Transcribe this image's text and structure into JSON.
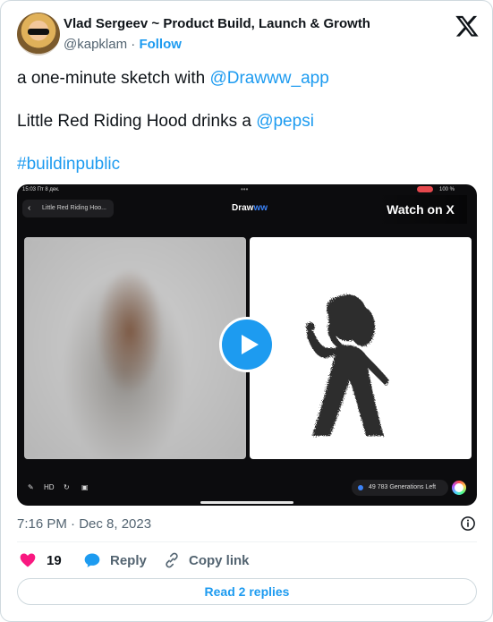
{
  "author": {
    "name": "Vlad Sergeev ~ Product Build, Launch & Growth",
    "handle": "@kapklam",
    "separator": "·",
    "follow_label": "Follow"
  },
  "tweet": {
    "line1_text": "a one-minute sketch with ",
    "line1_mention": "@Drawww_app",
    "line2_text": "Little Red Riding Hood drinks a ",
    "line2_mention": "@pepsi",
    "hashtag": "#buildinpublic"
  },
  "video": {
    "status_time": "15:03  Пт 8 дек.",
    "status_dots": "•••",
    "status_battery": "100 %",
    "app_title": "Little Red Riding Hoo...",
    "app_logo_main": "Draw",
    "app_logo_accent": "ww",
    "watch_label": "Watch on X",
    "tool_hd": "HD",
    "generations": "49 783 Generations Left"
  },
  "meta": {
    "timestamp": "7:16 PM · Dec 8, 2023"
  },
  "actions": {
    "likes_count": "19",
    "reply_label": "Reply",
    "copy_label": "Copy link",
    "read_replies_label": "Read 2 replies"
  },
  "colors": {
    "accent": "#1d9bf0",
    "like": "#f91880",
    "muted": "#536471"
  }
}
